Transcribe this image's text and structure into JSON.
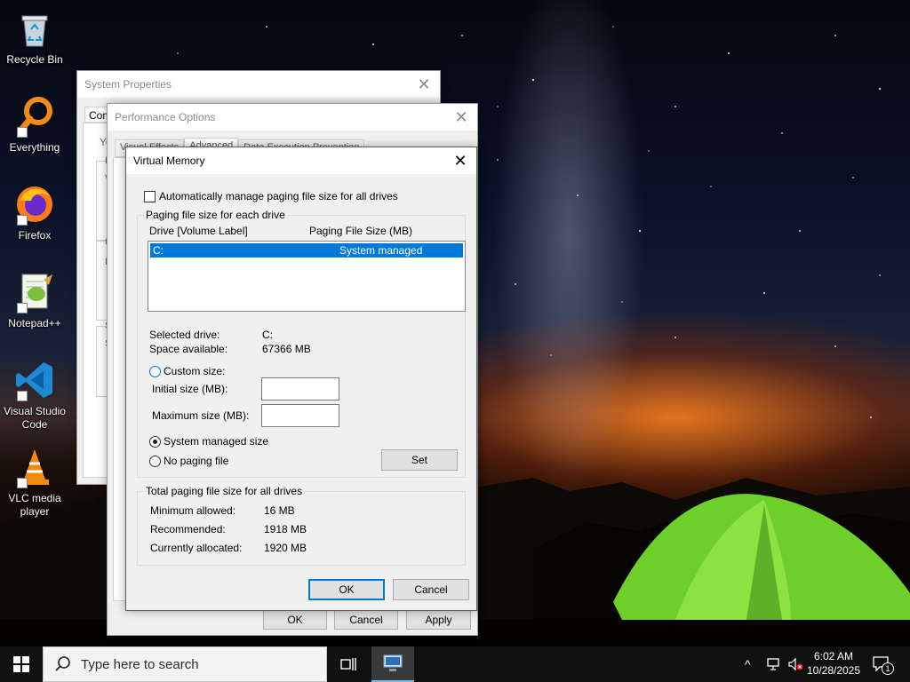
{
  "desktop": {
    "icons": [
      {
        "label": "Recycle Bin",
        "name": "recycle-bin-icon"
      },
      {
        "label": "Everything",
        "name": "everything-icon"
      },
      {
        "label": "Firefox",
        "name": "firefox-icon"
      },
      {
        "label": "Notepad++",
        "name": "notepadpp-icon"
      },
      {
        "label": "Visual Studio Code",
        "name": "vscode-icon"
      },
      {
        "label": "VLC media player",
        "name": "vlc-icon"
      }
    ]
  },
  "system_properties": {
    "title": "System Properties",
    "tab_partial": "Com",
    "text_partial": "Yo",
    "fragments": [
      "P",
      "V",
      "U",
      "D",
      "S",
      "S"
    ]
  },
  "performance_options": {
    "title": "Performance Options",
    "tabs": [
      "Visual Effects",
      "Advanced",
      "Data Execution Prevention"
    ],
    "buttons": {
      "ok": "OK",
      "cancel": "Cancel",
      "apply": "Apply"
    }
  },
  "virtual_memory": {
    "title": "Virtual Memory",
    "auto_manage_label": "Automatically manage paging file size for all drives",
    "auto_manage_checked": false,
    "drive_group_title": "Paging file size for each drive",
    "columns": {
      "drive": "Drive  [Volume Label]",
      "size": "Paging File Size (MB)"
    },
    "drives": [
      {
        "drive": "C:",
        "size": "System managed"
      }
    ],
    "selected_drive_label": "Selected drive:",
    "selected_drive_value": "C:",
    "space_available_label": "Space available:",
    "space_available_value": "67366 MB",
    "custom_size_label": "Custom size:",
    "initial_size_label": "Initial size (MB):",
    "initial_size_value": "",
    "maximum_size_label": "Maximum size (MB):",
    "maximum_size_value": "",
    "system_managed_label": "System managed size",
    "no_paging_label": "No paging file",
    "selected_option": "system_managed",
    "set_label": "Set",
    "totals_group_title": "Total paging file size for all drives",
    "min_allowed_label": "Minimum allowed:",
    "min_allowed_value": "16 MB",
    "recommended_label": "Recommended:",
    "recommended_value": "1918 MB",
    "allocated_label": "Currently allocated:",
    "allocated_value": "1920 MB",
    "ok_label": "OK",
    "cancel_label": "Cancel"
  },
  "taskbar": {
    "search_placeholder": "Type here to search",
    "time": "6:02 AM",
    "date": "10/28/2025",
    "notification_count": "1"
  }
}
